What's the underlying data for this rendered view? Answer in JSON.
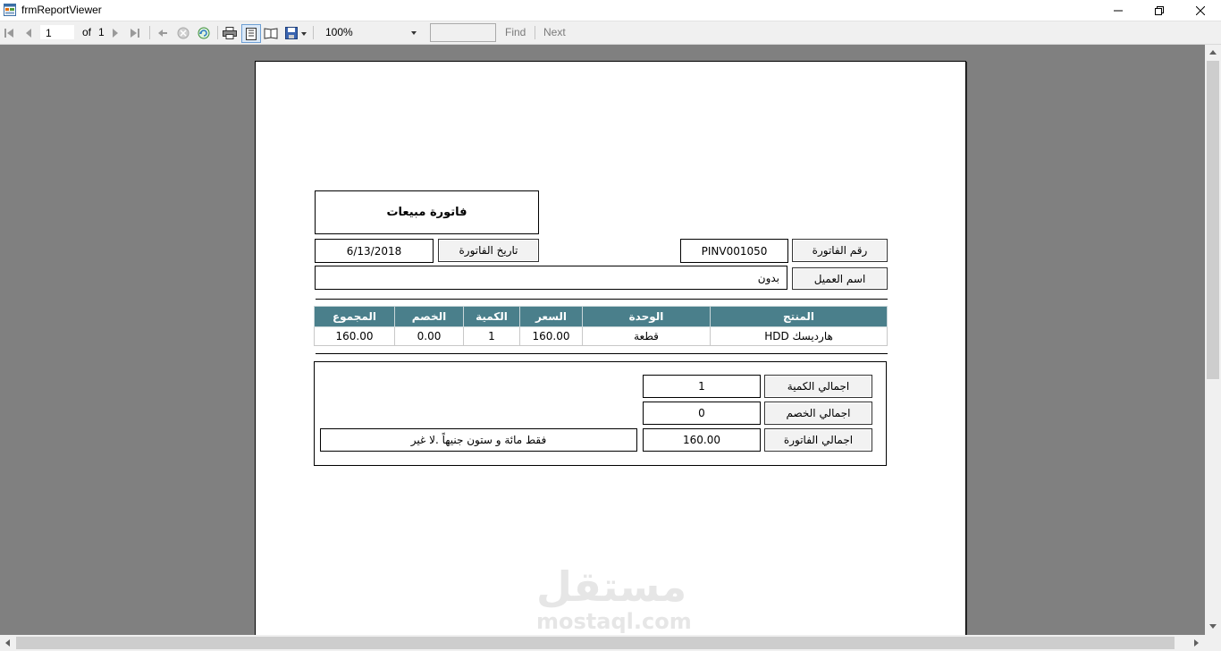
{
  "window": {
    "title": "frmReportViewer"
  },
  "toolbar": {
    "page_current": "1",
    "page_of": "of",
    "page_total": "1",
    "zoom": "100%",
    "find_label": "Find",
    "next_label": "Next"
  },
  "report": {
    "title": "فاتورة مبيعات",
    "date_label": "تاريخ الفاتورة",
    "date_value": "6/13/2018",
    "invoice_no_label": "رقم الفاتورة",
    "invoice_no_value": "PINV001050",
    "customer_label": "اسم العميل",
    "customer_value": "بدون",
    "table": {
      "headers": {
        "total": "المجموع",
        "discount": "الخصم",
        "qty": "الكمية",
        "price": "السعر",
        "unit": "الوحدة",
        "product": "المنتج"
      },
      "rows": [
        {
          "total": "160.00",
          "discount": "0.00",
          "qty": "1",
          "price": "160.00",
          "unit": "قطعة",
          "product": "HDD هارديسك"
        }
      ]
    },
    "totals": {
      "qty_label": "اجمالي الكمية",
      "qty_value": "1",
      "discount_label": "اجمالي الخصم",
      "discount_value": "0",
      "invoice_label": "اجمالي الفاتورة",
      "invoice_value": "160.00",
      "amount_words": "فقط مائة و ستون جنيهاً .لا غير"
    }
  },
  "watermark": {
    "arabic": "مستقل",
    "latin": "mostaql.com"
  }
}
